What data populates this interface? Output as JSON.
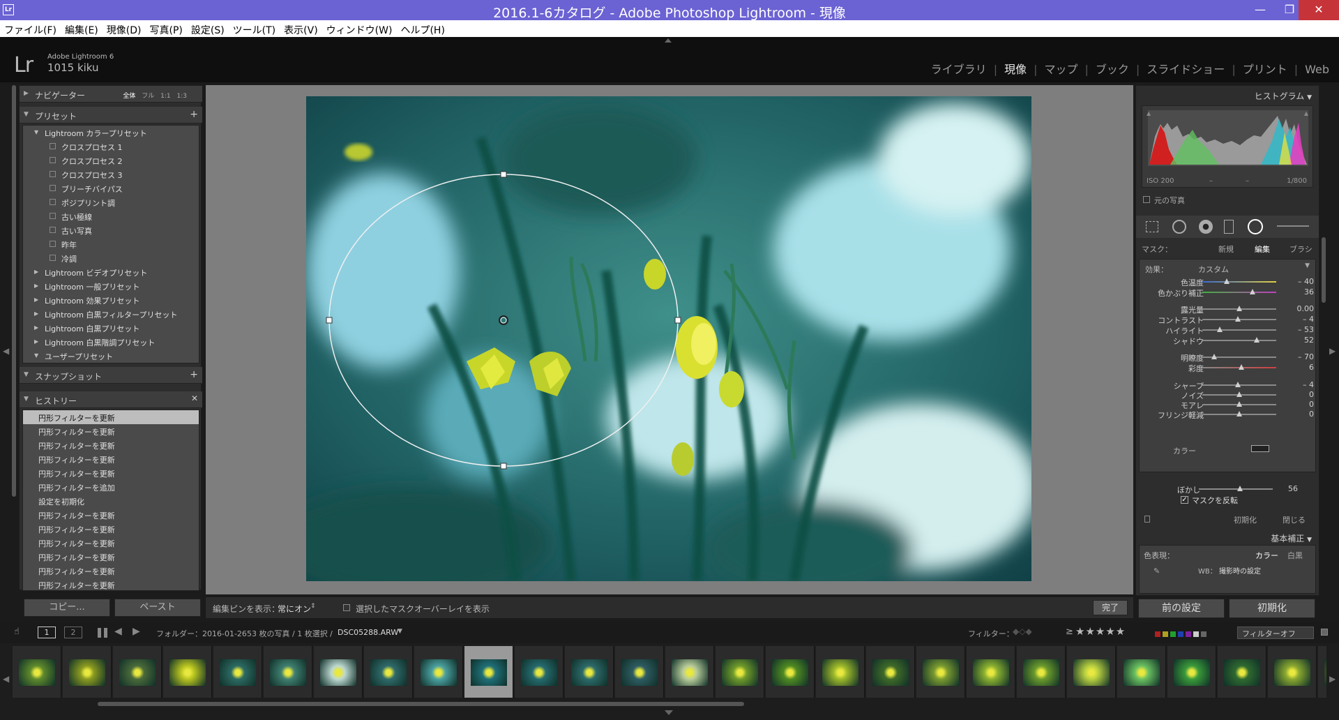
{
  "window": {
    "title": "2016.1-6カタログ - Adobe Photoshop Lightroom - 現像",
    "app_icon": "Lr",
    "minimize": "—",
    "maximize": "❐",
    "close": "✕"
  },
  "menu": [
    "ファイル(F)",
    "編集(E)",
    "現像(D)",
    "写真(P)",
    "設定(S)",
    "ツール(T)",
    "表示(V)",
    "ウィンドウ(W)",
    "ヘルプ(H)"
  ],
  "identity": {
    "logo": "Lr",
    "product": "Adobe Lightroom 6",
    "user": "1015 kiku"
  },
  "modules": [
    {
      "label": "ライブラリ",
      "active": false
    },
    {
      "label": "現像",
      "active": true
    },
    {
      "label": "マップ",
      "active": false
    },
    {
      "label": "ブック",
      "active": false
    },
    {
      "label": "スライドショー",
      "active": false
    },
    {
      "label": "プリント",
      "active": false
    },
    {
      "label": "Web",
      "active": false
    }
  ],
  "left": {
    "navigator": {
      "title": "ナビゲーター",
      "modes": [
        "全体",
        "フル",
        "1:1",
        "1:3"
      ]
    },
    "presets": {
      "title": "プリセット",
      "add": "+",
      "groups": [
        {
          "label": "Lightroom カラープリセット",
          "open": true,
          "items": [
            "クロスプロセス 1",
            "クロスプロセス 2",
            "クロスプロセス 3",
            "ブリーチバイパス",
            "ポジプリント調",
            "古い極線",
            "古い写真",
            "昨年",
            "冷調"
          ]
        },
        {
          "label": "Lightroom ビデオプリセット",
          "open": false
        },
        {
          "label": "Lightroom 一般プリセット",
          "open": false
        },
        {
          "label": "Lightroom 効果プリセット",
          "open": false
        },
        {
          "label": "Lightroom 白黒フィルタープリセット",
          "open": false
        },
        {
          "label": "Lightroom 白黒プリセット",
          "open": false
        },
        {
          "label": "Lightroom 白黒階調プリセット",
          "open": false
        },
        {
          "label": "ユーザープリセット",
          "open": true
        }
      ]
    },
    "snapshot": {
      "title": "スナップショット",
      "add": "+"
    },
    "history": {
      "title": "ヒストリー",
      "clear": "✕",
      "items": [
        "円形フィルターを更新",
        "円形フィルターを更新",
        "円形フィルターを更新",
        "円形フィルターを更新",
        "円形フィルターを更新",
        "円形フィルターを追加",
        "設定を初期化",
        "円形フィルターを更新",
        "円形フィルターを更新",
        "円形フィルターを更新",
        "円形フィルターを更新",
        "円形フィルターを更新",
        "円形フィルターを更新"
      ],
      "selected_index": 0
    },
    "copy_button": "コピー...",
    "paste_button": "ペースト"
  },
  "toolbar": {
    "pin_label": "編集ピンを表示：",
    "pin_value": "常にオン",
    "overlay_label": "選択したマスクオーバーレイを表示",
    "done_button": "完了"
  },
  "right": {
    "histogram": {
      "title": "ヒストグラム",
      "iso": "ISO 200",
      "dash1": "–",
      "dash2": "–",
      "shutter": "1/800",
      "original_label": "元の写真"
    },
    "mask": {
      "label": "マスク：",
      "new": "新規",
      "edit": "編集",
      "brush": "ブラシ"
    },
    "effect": {
      "label": "効果：",
      "value": "カスタム"
    },
    "sliders": [
      {
        "label": "色温度",
        "value": "– 40",
        "pos": 0.33
      },
      {
        "label": "色かぶり補正",
        "value": "36",
        "pos": 0.68
      },
      {
        "label": "露光量",
        "value": "0.00",
        "pos": 0.5
      },
      {
        "label": "コントラスト",
        "value": "– 4",
        "pos": 0.48
      },
      {
        "label": "ハイライト",
        "value": "– 53",
        "pos": 0.24
      },
      {
        "label": "シャドウ",
        "value": "52",
        "pos": 0.74
      },
      {
        "label": "明瞭度",
        "value": "– 70",
        "pos": 0.16
      },
      {
        "label": "彩度",
        "value": "6",
        "pos": 0.53
      },
      {
        "label": "シャープ",
        "value": "– 4",
        "pos": 0.48
      },
      {
        "label": "ノイズ",
        "value": "0",
        "pos": 0.5
      },
      {
        "label": "モアレ",
        "value": "0",
        "pos": 0.5
      },
      {
        "label": "フリンジ軽減",
        "value": "0",
        "pos": 0.5
      }
    ],
    "color_label": "カラー",
    "feather": {
      "label": "ぼかし",
      "value": "56",
      "pos": 0.56
    },
    "invert_mask": "マスクを反転",
    "reset": "初期化",
    "close": "閉じる",
    "basic": {
      "title": "基本補正",
      "treatment_label": "色表現：",
      "color": "カラー",
      "bw": "白黒",
      "wb_label": "WB：",
      "wb_value": "撮影時の設定"
    },
    "prev_button": "前の設定",
    "reset_button": "初期化"
  },
  "filmbar": {
    "page1": "1",
    "page2": "2",
    "folder": "フォルダー：2016-01-26",
    "count": "53 枚の写真 / 1 枚選択 /",
    "filename": "DSC05288.ARW",
    "filter_label": "フィルター：",
    "rating_op": "≥",
    "stars": "★★★★★",
    "filter_off": "フィルターオフ"
  },
  "filmstrip": {
    "thumbs": [
      {
        "color": "#5f8a2c"
      },
      {
        "color": "#8a9a20"
      },
      {
        "color": "#4a6a3a"
      },
      {
        "color": "#b8c420"
      },
      {
        "color": "#2c6a62"
      },
      {
        "color": "#3f7f70"
      },
      {
        "color": "#bcd8d0"
      },
      {
        "color": "#2f6a6a"
      },
      {
        "color": "#4aa0a0"
      },
      {
        "color": "#1f6f78",
        "selected": true
      },
      {
        "color": "#256a6e"
      },
      {
        "color": "#2c6a6a"
      },
      {
        "color": "#2e5c62"
      },
      {
        "color": "#b8cc9a"
      },
      {
        "color": "#6f9a2a"
      },
      {
        "color": "#4f8a22"
      },
      {
        "color": "#9cb82a"
      },
      {
        "color": "#3f6a28"
      },
      {
        "color": "#7a9a30"
      },
      {
        "color": "#8ab030"
      },
      {
        "color": "#6a9a2c"
      },
      {
        "color": "#b8d040"
      },
      {
        "color": "#6ac060"
      },
      {
        "color": "#3a9a3a"
      },
      {
        "color": "#2f6a30"
      },
      {
        "color": "#8aa830"
      },
      {
        "color": "#6a7a20"
      }
    ]
  },
  "icons": {
    "collapse_left": "◀",
    "collapse_right": "▶",
    "top_toggle": "▲",
    "bottom_toggle": "▼"
  }
}
